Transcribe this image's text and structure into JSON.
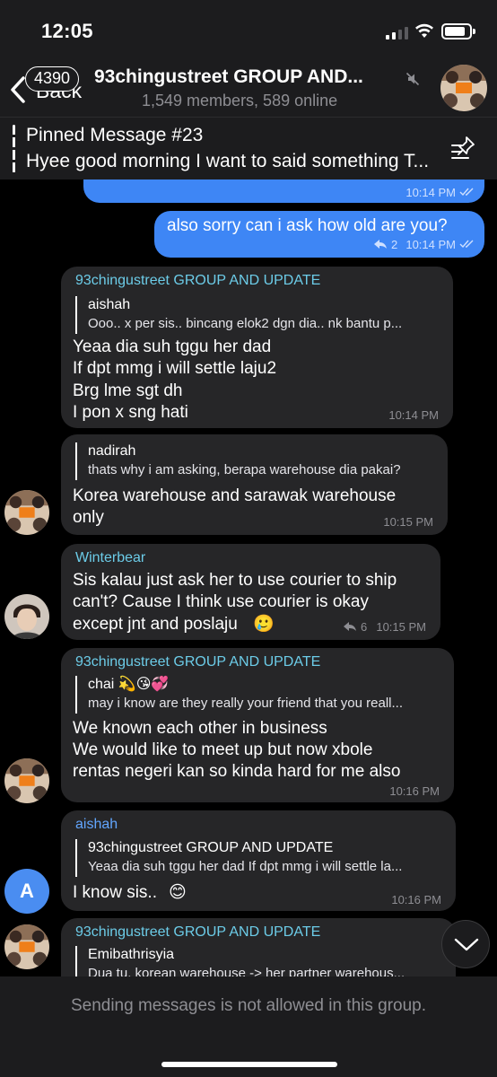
{
  "status_bar": {
    "time": "12:05"
  },
  "header": {
    "back_label": "Back",
    "unread_badge": "4390",
    "title": "93chingustreet GROUP AND...",
    "subtitle": "1,549 members, 589 online"
  },
  "pinned": {
    "title": "Pinned Message #23",
    "text": "Hyee good morning I want to said something T..."
  },
  "messages": [
    {
      "id": "out1",
      "direction": "out",
      "time": "10:14 PM",
      "status": "read"
    },
    {
      "id": "out2",
      "direction": "out",
      "text": "also sorry can i ask how old are you?",
      "reply_count": "2",
      "time": "10:14 PM",
      "status": "read"
    },
    {
      "id": "m1",
      "sender": "93chingustreet GROUP AND UPDATE",
      "reply": {
        "name": "aishah",
        "text": "Ooo.. x per sis.. bincang elok2 dgn dia.. nk bantu p..."
      },
      "lines": [
        "Yeaa dia suh tggu her dad",
        "If dpt mmg i will settle laju2",
        "Brg lme sgt dh",
        "I pon x sng hati"
      ],
      "time": "10:14 PM"
    },
    {
      "id": "m2",
      "reply": {
        "name": "nadirah",
        "text": "thats why i am asking, berapa warehouse dia pakai?"
      },
      "lines": [
        "Korea warehouse and sarawak warehouse",
        "only"
      ],
      "time": "10:15 PM"
    },
    {
      "id": "m3",
      "sender": "Winterbear",
      "lines": [
        "Sis kalau just ask her to use courier to ship",
        "can't? Cause I think use courier is okay",
        "except jnt and poslaju"
      ],
      "emoji": "🥲",
      "reply_count": "6",
      "time": "10:15 PM"
    },
    {
      "id": "m4",
      "sender": "93chingustreet GROUP AND UPDATE",
      "reply": {
        "name": "chai 💫😘💞",
        "text": "may i know are they really your friend that you reall..."
      },
      "lines": [
        "We known each other in business",
        "We would like to meet up but now xbole",
        "rentas negeri kan so kinda hard for me also"
      ],
      "time": "10:16 PM"
    },
    {
      "id": "m5",
      "sender": "aishah",
      "reply": {
        "name": "93chingustreet GROUP AND UPDATE",
        "text": "Yeaa dia suh tggu her dad If dpt mmg i will settle la..."
      },
      "lines": [
        "I know sis.."
      ],
      "emoji": "😊",
      "avatar_letter": "A",
      "time": "10:16 PM"
    },
    {
      "id": "m6",
      "sender": "93chingustreet GROUP AND UPDATE",
      "reply": {
        "name": "Emibathrisyia",
        "text": "Dua tu, korean warehouse -> her partner warehous..."
      }
    }
  ],
  "footer": {
    "notice": "Sending messages is not allowed in this group."
  },
  "colors": {
    "outgoing": "#3e86f5",
    "incoming": "#262628",
    "sender": "#6ccce8",
    "background": "#000000"
  },
  "icons": [
    "back-chevron-icon",
    "mute-icon",
    "pin-list-icon",
    "read-checks-icon",
    "reply-arrow-icon",
    "scroll-down-chevron-icon",
    "signal-icon",
    "wifi-icon",
    "battery-icon"
  ]
}
